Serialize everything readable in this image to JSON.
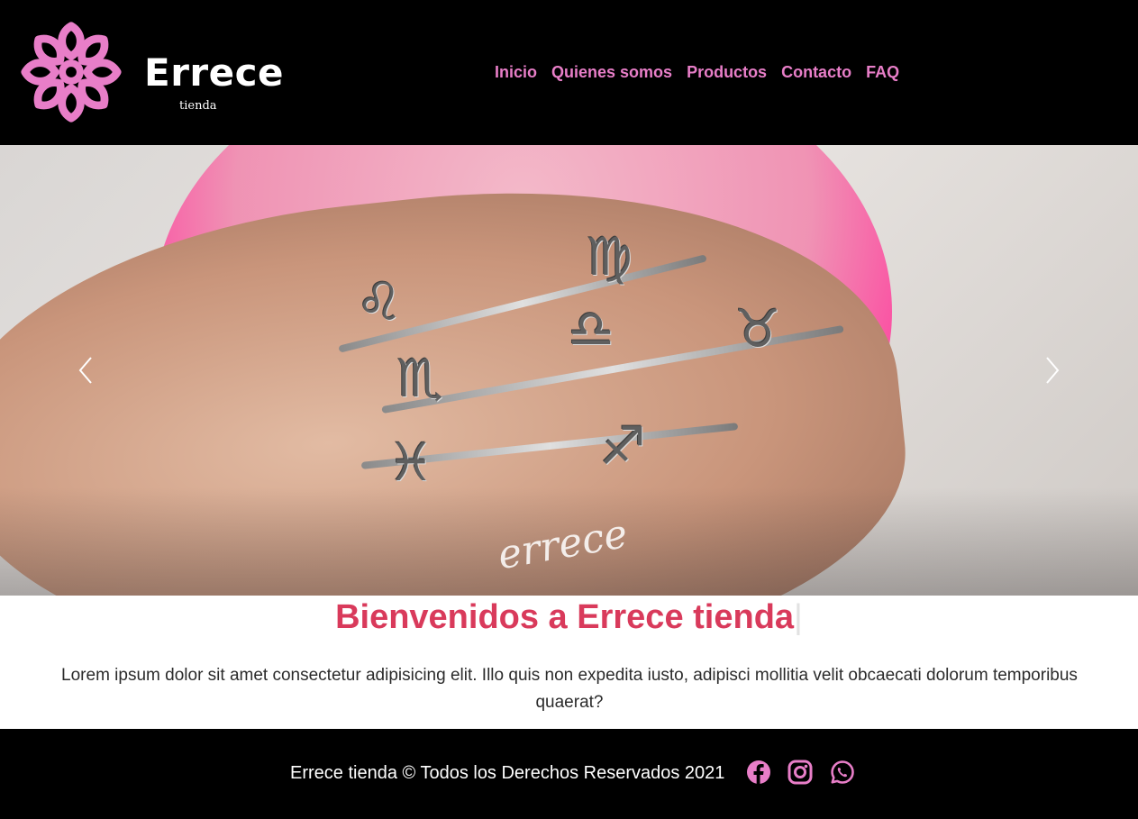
{
  "brand": {
    "name": "Errece",
    "subtitle": "tienda",
    "accent_color": "#e87ec8",
    "logo_icon": "flower-mandala-icon"
  },
  "nav": {
    "items": [
      {
        "label": "Inicio"
      },
      {
        "label": "Quienes somos"
      },
      {
        "label": "Productos"
      },
      {
        "label": "Contacto"
      },
      {
        "label": "FAQ"
      }
    ]
  },
  "hero": {
    "watermark": "errece",
    "prev_icon": "chevron-left-icon",
    "next_icon": "chevron-right-icon"
  },
  "main": {
    "title": "Bienvenidos a Errece tienda",
    "title_color": "#d93a5b",
    "caret": "|",
    "body": "Lorem ipsum dolor sit amet consectetur adipisicing elit. Illo quis non expedita iusto, adipisci mollitia velit obcaecati dolorum temporibus quaerat?"
  },
  "footer": {
    "copyright": "Errece tienda © Todos los Derechos Reservados 2021",
    "social": [
      {
        "icon": "facebook-icon",
        "color": "#e87ec8"
      },
      {
        "icon": "instagram-icon",
        "color": "#e87ec8"
      },
      {
        "icon": "whatsapp-icon",
        "color": "#e87ec8"
      }
    ]
  }
}
